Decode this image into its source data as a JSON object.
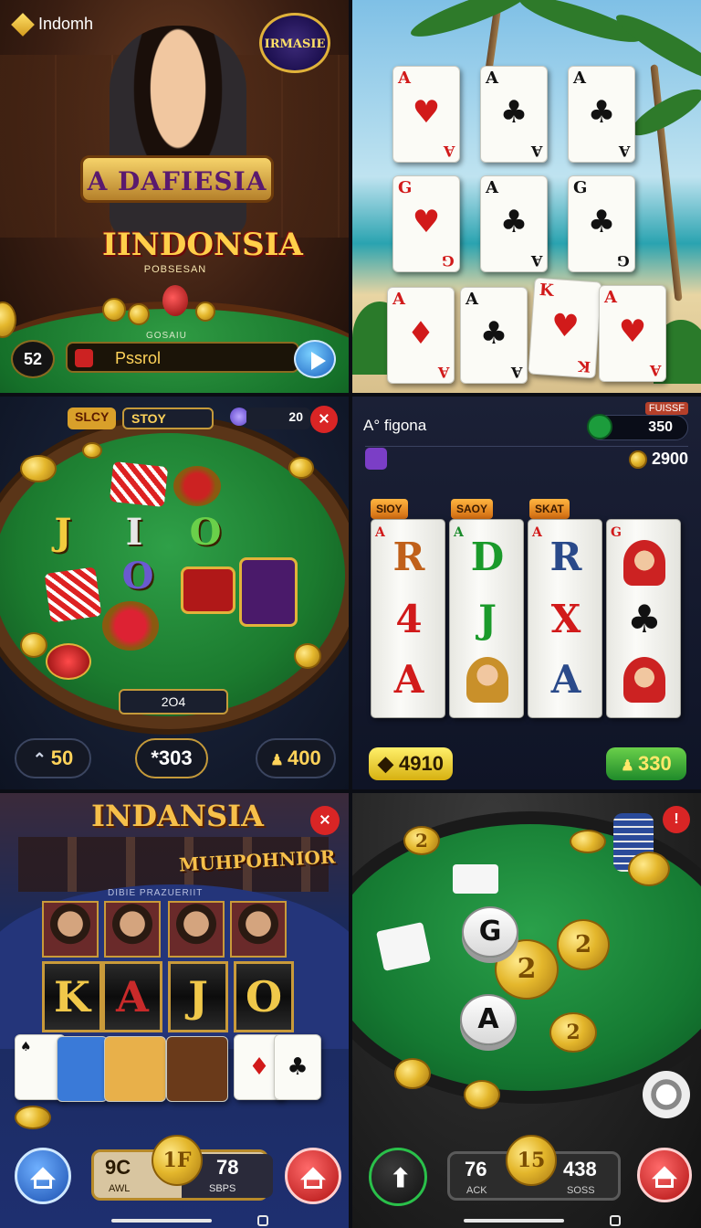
{
  "panel1": {
    "brand": "Indomh",
    "badge": "IRMASIE",
    "banner": "A DAFIESIA",
    "title": "IINDONSIA",
    "subtitle": "POBSESAN",
    "table_text": "GOSAIU",
    "counter": "52",
    "bar_label": "Pssrol"
  },
  "panel2": {
    "cards": [
      {
        "rank": "A",
        "suit": "♥",
        "color": "red"
      },
      {
        "rank": "A",
        "suit": "♣",
        "color": "black"
      },
      {
        "rank": "A",
        "suit": "♣",
        "color": "black"
      },
      {
        "rank": "G",
        "suit": "♥",
        "color": "red"
      },
      {
        "rank": "A",
        "suit": "♣",
        "color": "black"
      },
      {
        "rank": "G",
        "suit": "♣",
        "color": "black"
      },
      {
        "rank": "A",
        "suit": "♦",
        "color": "red"
      },
      {
        "rank": "A",
        "suit": "♣",
        "color": "black"
      },
      {
        "rank": "K",
        "suit": "♥",
        "color": "red"
      },
      {
        "rank": "A",
        "suit": "♥",
        "color": "red"
      }
    ]
  },
  "panel3": {
    "tag_left": "SLCY",
    "tag_mid": "STOY",
    "score": "20",
    "letters": [
      "J",
      "I",
      "O",
      "O"
    ],
    "bottom_tag": "2O4",
    "stat_left": "50",
    "stat_mid": "*303",
    "stat_right": "400"
  },
  "panel4": {
    "brand": "figona",
    "top_tag": "FUISSF",
    "score": "350",
    "coins": "2900",
    "col_tags": [
      "SIOY",
      "SAOY",
      "SKAT"
    ],
    "columns": [
      {
        "corner": "A",
        "top": "R",
        "mid": "4",
        "bot": "A"
      },
      {
        "corner": "A",
        "top": "D",
        "mid": "J",
        "bot": ""
      },
      {
        "corner": "A",
        "top": "R",
        "mid": "X",
        "bot": "A"
      },
      {
        "corner": "G",
        "top": "",
        "mid": "♣",
        "bot": ""
      }
    ],
    "btn_left": "4910",
    "btn_right": "330"
  },
  "panel5": {
    "title": "INDANSIA",
    "subtitle": "MUHPOHNIOR",
    "tiny": "DIBIE PRAZUERIIT",
    "reels": [
      "K",
      "A",
      "J",
      "O"
    ],
    "coin_label": "1F",
    "left_value": "9C",
    "left_caption": "AWL",
    "right_value": "78",
    "right_caption": "SBPS"
  },
  "panel6": {
    "letter_g": "G",
    "letter_a": "A",
    "coin_values": [
      "2",
      "2",
      "2",
      "2"
    ],
    "left_value": "76",
    "left_caption": "ACK",
    "coin_label": "15",
    "right_value": "438",
    "right_caption": "SOSS"
  },
  "colors": {
    "gold": "#f2cc3e",
    "felt": "#1b7a2e",
    "home_red": "#d92525",
    "home_blue": "#2a6fd8"
  }
}
